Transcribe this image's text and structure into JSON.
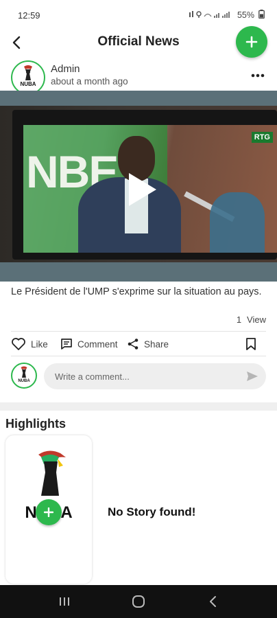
{
  "status_bar": {
    "time": "12:59",
    "battery": "55%"
  },
  "header": {
    "title": "Official News"
  },
  "post": {
    "author": "Admin",
    "time": "about a month ago",
    "logo_text": "NUBA",
    "caption": "Le Président de l'UMP s'exprime sur la situation au pays.",
    "views_count": "1",
    "views_label": "View",
    "video_banner_text": "NBE",
    "video_channel_badge": "RTG"
  },
  "actions": {
    "like": "Like",
    "comment": "Comment",
    "share": "Share"
  },
  "comment_box": {
    "placeholder": "Write a comment..."
  },
  "highlights": {
    "title": "Highlights",
    "card_logo_text": "NUBA",
    "empty_message": "No Story found!"
  },
  "colors": {
    "accent": "#2db84d"
  }
}
